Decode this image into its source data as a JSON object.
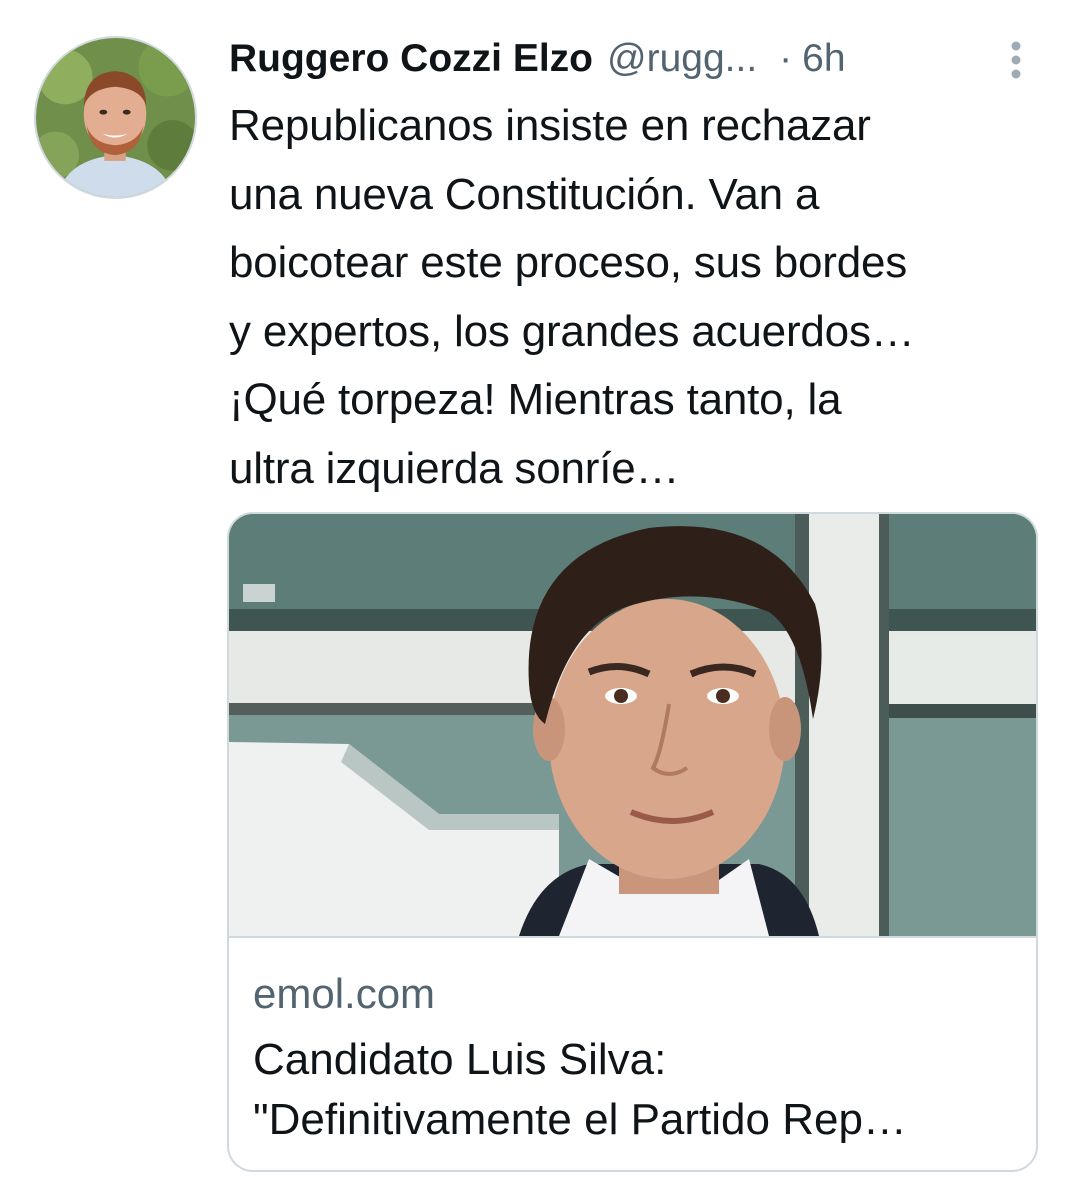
{
  "tweet": {
    "author": {
      "display_name": "Ruggero Cozzi Elzo",
      "handle": "@rugg...",
      "avatar_icon": "profile-photo"
    },
    "separator": "·",
    "timestamp": "6h",
    "more_icon": "vertical-dots-icon",
    "text_lines": [
      "Republicanos insiste en rechazar",
      "una nueva Constitución. Van a",
      "boicotear este proceso, sus bordes",
      "y expertos, los grandes acuerdos…",
      "¡Qué torpeza! Mientras tanto, la",
      "ultra izquierda sonríe…"
    ],
    "card": {
      "image": "portrait-photo",
      "domain": "emol.com",
      "title_lines": [
        "Candidato Luis Silva:",
        "\"Definitivamente el Partido Rep…"
      ]
    }
  },
  "colors": {
    "text_primary": "#0f1419",
    "text_secondary": "#536471",
    "border": "#cfd9de",
    "background": "#ffffff"
  }
}
